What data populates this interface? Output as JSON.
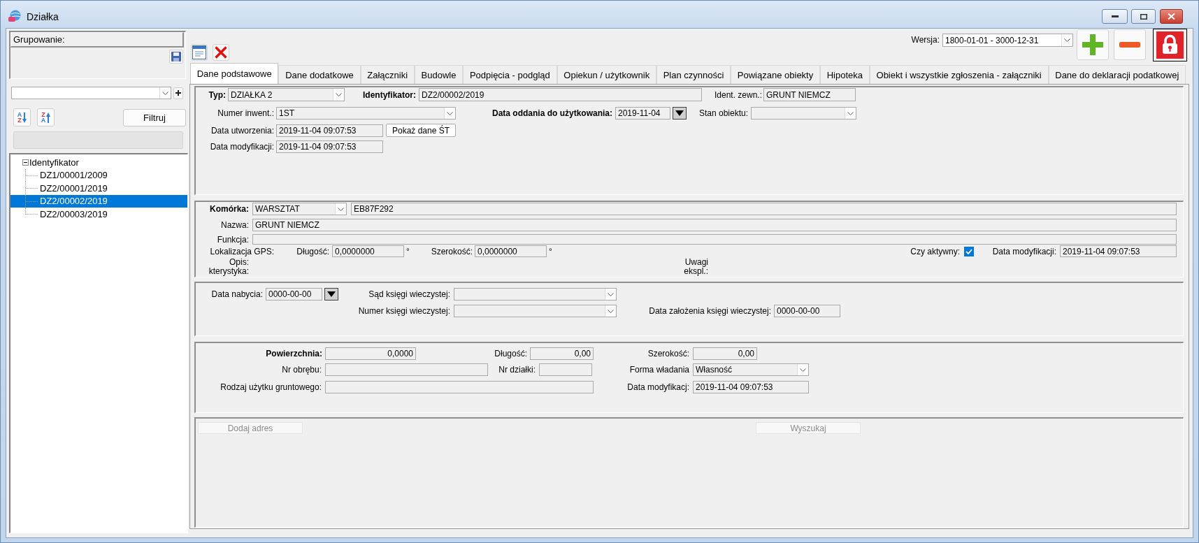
{
  "window": {
    "title": "Działka"
  },
  "sidebar": {
    "grouping": {
      "label": "Grupowanie:"
    },
    "sort_buttons": [
      {
        "kind": "down",
        "letters": [
          {
            "text": "A",
            "color": "#2a7fd4"
          },
          {
            "text": "Z",
            "color": "#e0353d"
          }
        ]
      },
      {
        "kind": "up",
        "letters": [
          {
            "text": "Z",
            "color": "#e0353d"
          },
          {
            "text": "A",
            "color": "#2a7fd4"
          }
        ]
      }
    ],
    "filter_button": "Filtruj",
    "tree": [
      {
        "label": "Identyfikator",
        "expanded": true,
        "selected": false,
        "children": [
          {
            "label": "DZ1/00001/2009",
            "selected": false
          },
          {
            "label": "DZ2/00001/2019",
            "selected": false
          },
          {
            "label": "DZ2/00002/2019",
            "selected": true
          },
          {
            "label": "DZ2/00003/2019",
            "selected": false
          }
        ]
      }
    ]
  },
  "toolbar": {
    "version": {
      "label": "Wersja:",
      "value": "1800-01-01 - 3000-12-31"
    }
  },
  "tabs": [
    {
      "label": "Dane podstawowe",
      "selected": true
    },
    {
      "label": "Dane dodatkowe",
      "selected": false
    },
    {
      "label": "Załączniki",
      "selected": false
    },
    {
      "label": "Budowle",
      "selected": false
    },
    {
      "label": "Podpięcia - podgląd",
      "selected": false
    },
    {
      "label": "Opiekun / użytkownik",
      "selected": false
    },
    {
      "label": "Plan czynności",
      "selected": false
    },
    {
      "label": "Powiązane obiekty",
      "selected": false
    },
    {
      "label": "Hipoteka",
      "selected": false
    },
    {
      "label": "Obiekt i wszystkie zgłoszenia - załączniki",
      "selected": false
    },
    {
      "label": "Dane do deklaracji podatkowej",
      "selected": false
    }
  ],
  "basic": {
    "type": {
      "label": "Typ:",
      "value": "DZIAŁKA 2"
    },
    "identifier": {
      "label": "Identyfikator:",
      "value": "DZ2/00002/2019"
    },
    "external_id": {
      "label": "Ident. zewn.:",
      "value": "GRUNT NIEMCZ"
    },
    "inventory_number": {
      "label": "Numer inwent.:",
      "value": "1ST"
    },
    "commissioning_date": {
      "label": "Data oddania do użytkowania:",
      "value": "2019-11-04"
    },
    "object_state": {
      "label": "Stan obiektu:"
    },
    "created": {
      "label": "Data utworzenia:",
      "value": "2019-11-04 09:07:53"
    },
    "show_fixed_asset_button": "Pokaż dane ŚT",
    "modified": {
      "label": "Data modyfikacji:",
      "value": "2019-11-04 09:07:53"
    }
  },
  "cell": {
    "cell": {
      "label": "Komórka:",
      "value": "WARSZTAT",
      "code": "EB87F292"
    },
    "name": {
      "label": "Nazwa:",
      "value": "GRUNT NIEMCZ"
    },
    "function": {
      "label": "Funkcja:"
    },
    "gps": {
      "label": "Lokalizacja GPS:",
      "longitude": {
        "label": "Długość:",
        "value": "0,0000000",
        "unit": "°"
      },
      "latitude": {
        "label": "Szerokość:",
        "value": "0,0000000",
        "unit": "°"
      }
    },
    "active": {
      "label": "Czy aktywny:",
      "checked": true
    },
    "modified": {
      "label": "Data modyfikacji:",
      "value": "2019-11-04 09:07:53"
    },
    "description": {
      "label": "Opis:"
    },
    "characteristics": {
      "label": "kterystyka:"
    },
    "remarks": {
      "label": "Uwagi ekspl.:"
    }
  },
  "land_register": {
    "acquisition_date": {
      "label": "Data nabycia:",
      "value": "0000-00-00"
    },
    "court": {
      "label": "Sąd księgi wieczystej:"
    },
    "register_number": {
      "label": "Numer księgi wieczystej:"
    },
    "establishment_date": {
      "label": "Data założenia księgi wieczystej:",
      "value": "0000-00-00"
    }
  },
  "area": {
    "area": {
      "label": "Powierzchnia:",
      "value": "0,0000"
    },
    "length": {
      "label": "Długość:",
      "value": "0,00"
    },
    "width": {
      "label": "Szerokość:",
      "value": "0,00"
    },
    "precinct": {
      "label": "Nr obrębu:"
    },
    "plot_number": {
      "label": "Nr działki:"
    },
    "ownership": {
      "label": "Forma władania",
      "value": "Własność"
    },
    "land_use": {
      "label": "Rodzaj użytku gruntowego:"
    },
    "modified": {
      "label": "Data modyfikacj:",
      "value": "2019-11-04 09:07:53"
    }
  },
  "address": {
    "add_button": {
      "label": "Dodaj adres",
      "disabled": true
    },
    "search_button": {
      "label": "Wyszukaj",
      "disabled": true
    }
  }
}
